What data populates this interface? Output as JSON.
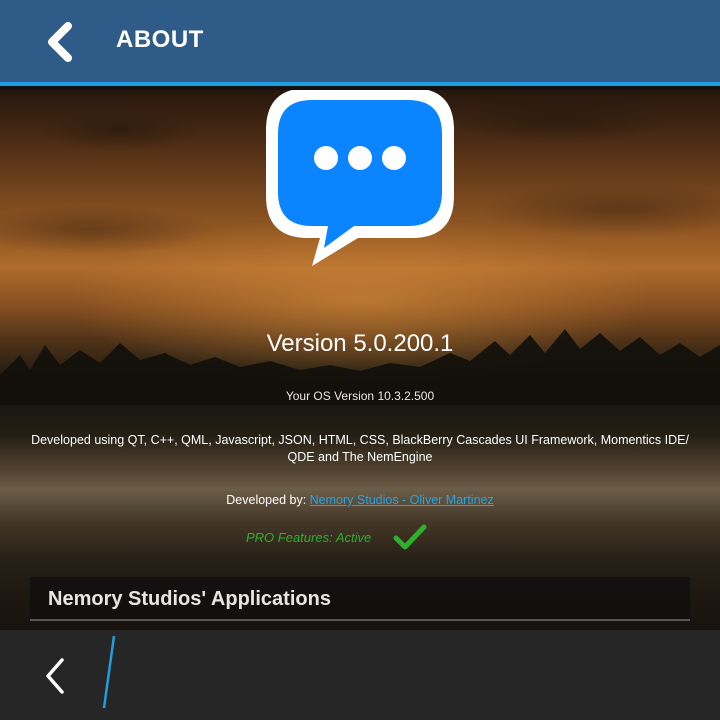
{
  "header": {
    "title": "ABOUT",
    "back_icon": "chevron-left-icon"
  },
  "logo": {
    "icon": "chat-bubble-icon",
    "color": "#0a84ff"
  },
  "about": {
    "version": "Version 5.0.200.1",
    "os_version": "Your OS Version 10.3.2.500",
    "developed_using": "Developed using QT, C++, QML, Javascript, JSON, HTML, CSS, BlackBerry Cascades UI Framework, Momentics IDE/ QDE and The NemEngine",
    "developed_by_label": "Developed by: ",
    "developer_link": "Nemory Studios - Oliver Martinez",
    "pro_status": "PRO Features: Active",
    "pro_icon": "checkmark-icon"
  },
  "apps_section": {
    "title": "Nemory Studios' Applications"
  },
  "action_bar": {
    "back_icon": "chevron-left-icon"
  },
  "colors": {
    "title_bar": "#2e5b87",
    "accent": "#1f9fe0",
    "link": "#24a6e8",
    "pro_green": "#2bb12b"
  }
}
